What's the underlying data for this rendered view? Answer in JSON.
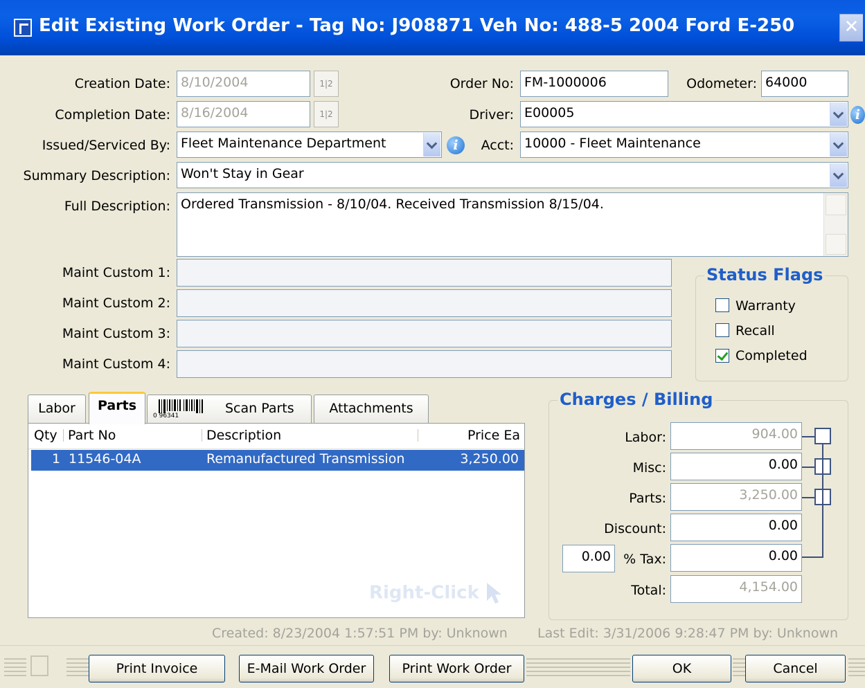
{
  "window": {
    "title": "Edit Existing Work Order - Tag No: J908871 Veh No: 488-5 2004 Ford E-250"
  },
  "form": {
    "creation_date": {
      "label": "Creation Date:",
      "value": "8/10/2004"
    },
    "completion_date": {
      "label": "Completion Date:",
      "value": "8/16/2004"
    },
    "calendar_glyph": "1|2",
    "order_no": {
      "label": "Order No:",
      "value": "FM-1000006"
    },
    "odometer": {
      "label": "Odometer:",
      "value": "64000"
    },
    "driver": {
      "label": "Driver:",
      "value": "E00005"
    },
    "issued_by": {
      "label": "Issued/Serviced By:",
      "value": "Fleet Maintenance Department"
    },
    "acct": {
      "label": "Acct:",
      "value": "10000 - Fleet Maintenance"
    },
    "summary": {
      "label": "Summary Description:",
      "value": "Won't Stay in Gear"
    },
    "full_description": {
      "label": "Full Description:",
      "value": "Ordered Transmission - 8/10/04.  Received Transmission 8/15/04."
    },
    "custom": [
      {
        "label": "Maint Custom 1:",
        "value": ""
      },
      {
        "label": "Maint Custom 2:",
        "value": ""
      },
      {
        "label": "Maint Custom 3:",
        "value": ""
      },
      {
        "label": "Maint Custom 4:",
        "value": ""
      }
    ]
  },
  "status_flags": {
    "title": "Status Flags",
    "items": [
      {
        "label": "Warranty",
        "checked": false
      },
      {
        "label": "Recall",
        "checked": false
      },
      {
        "label": "Completed",
        "checked": true
      }
    ]
  },
  "tabs": [
    {
      "label": "Labor",
      "active": false
    },
    {
      "label": "Parts",
      "active": true
    },
    {
      "label": "Scan Parts",
      "active": false
    },
    {
      "label": "Attachments",
      "active": false
    }
  ],
  "barcode_digits": "0 96341",
  "parts_table": {
    "columns": [
      "Qty",
      "Part No",
      "Description",
      "Price Ea"
    ],
    "rows": [
      {
        "qty": "1",
        "part_no": "11546-04A",
        "description": "Remanufactured Transmission",
        "price": "3,250.00",
        "selected": true
      }
    ],
    "watermark": "Right-Click"
  },
  "charges": {
    "title": "Charges / Billing",
    "labor": {
      "label": "Labor:",
      "value": "904.00"
    },
    "misc": {
      "label": "Misc:",
      "value": "0.00"
    },
    "parts": {
      "label": "Parts:",
      "value": "3,250.00"
    },
    "discount": {
      "label": "Discount:",
      "value": "0.00"
    },
    "tax_rate": "0.00",
    "tax": {
      "label": "% Tax:",
      "value": "0.00"
    },
    "total": {
      "label": "Total:",
      "value": "4,154.00"
    }
  },
  "footer": {
    "created": "Created: 8/23/2004 1:57:51 PM by: Unknown",
    "last_edit": "Last Edit: 3/31/2006 9:28:47 PM by: Unknown"
  },
  "buttons": {
    "print_invoice": "Print Invoice",
    "email_work_order": "E-Mail Work Order",
    "print_work_order": "Print Work Order",
    "ok": "OK",
    "cancel": "Cancel"
  },
  "colors": {
    "title_bar": "#0b5ee0",
    "group_title": "#1f5ec9",
    "selection": "#316ac5",
    "window_bg": "#ece9d8"
  }
}
